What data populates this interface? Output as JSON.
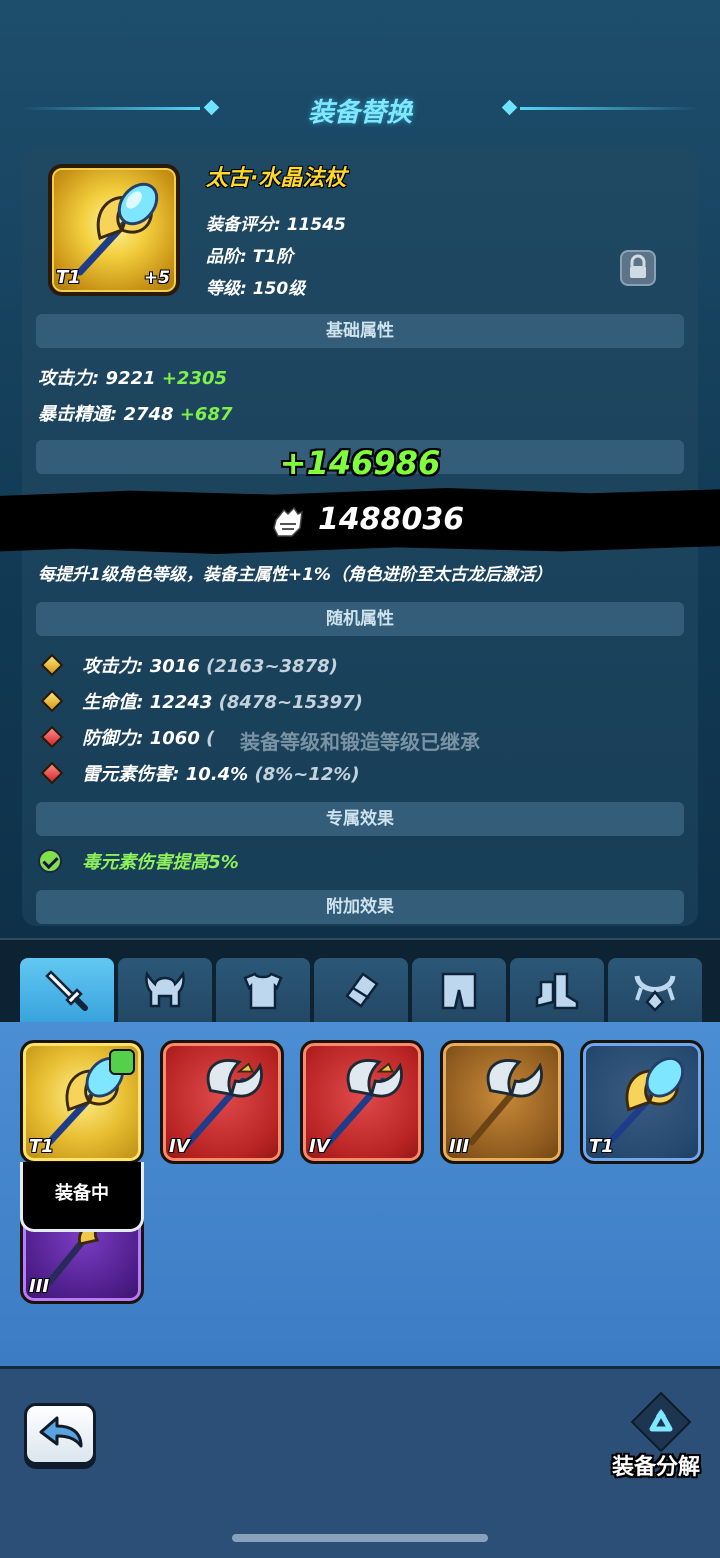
{
  "header": {
    "title": "装备替换"
  },
  "item": {
    "name": "太古·水晶法杖",
    "score": "装备评分: 11545",
    "grade": "品阶: T1阶",
    "level": "等级: 150级",
    "tier": "T1",
    "enhance": "+5",
    "locked": true
  },
  "sections": {
    "base": "基础属性",
    "random": "随机属性",
    "exclusive": "专属效果",
    "extra": "附加效果"
  },
  "base_stats": [
    {
      "label": "攻击力: 9221",
      "bonus": "+2305"
    },
    {
      "label": "暴击精通: 2748",
      "bonus": "+687"
    }
  ],
  "growth_note": "每提升1级角色等级，装备主属性+1%（角色进阶至太古龙后激活）",
  "random_stats": [
    {
      "label": "攻击力: 3016",
      "range": "(2163~3878)",
      "color": "gold"
    },
    {
      "label": "生命值: 12243",
      "range": "(8478~15397)",
      "color": "gold"
    },
    {
      "label": "防御力: 1060",
      "range": "(",
      "color": "red"
    },
    {
      "label": "雷元素伤害: 10.4%",
      "range": "(8%~12%)",
      "color": "red"
    }
  ],
  "exclusive_effect": "毒元素伤害提高5%",
  "power": {
    "gain": "+146986",
    "total": "1488036"
  },
  "inherit_note": "装备等级和锻造等级已继承",
  "tabs": [
    "weapon-icon",
    "helmet-icon",
    "armor-icon",
    "bracer-icon",
    "pants-icon",
    "boots-icon",
    "necklace-icon"
  ],
  "inventory": [
    {
      "tier": "T1",
      "rarity": "gold",
      "equipped": true
    },
    {
      "tier": "IV",
      "rarity": "red"
    },
    {
      "tier": "IV",
      "rarity": "red"
    },
    {
      "tier": "III",
      "rarity": "brown"
    },
    {
      "tier": "T1",
      "rarity": "blue"
    },
    {
      "tier": "III",
      "rarity": "purple"
    }
  ],
  "equipped_label": "装备中",
  "bottom": {
    "decompose_label": "装备分解"
  }
}
